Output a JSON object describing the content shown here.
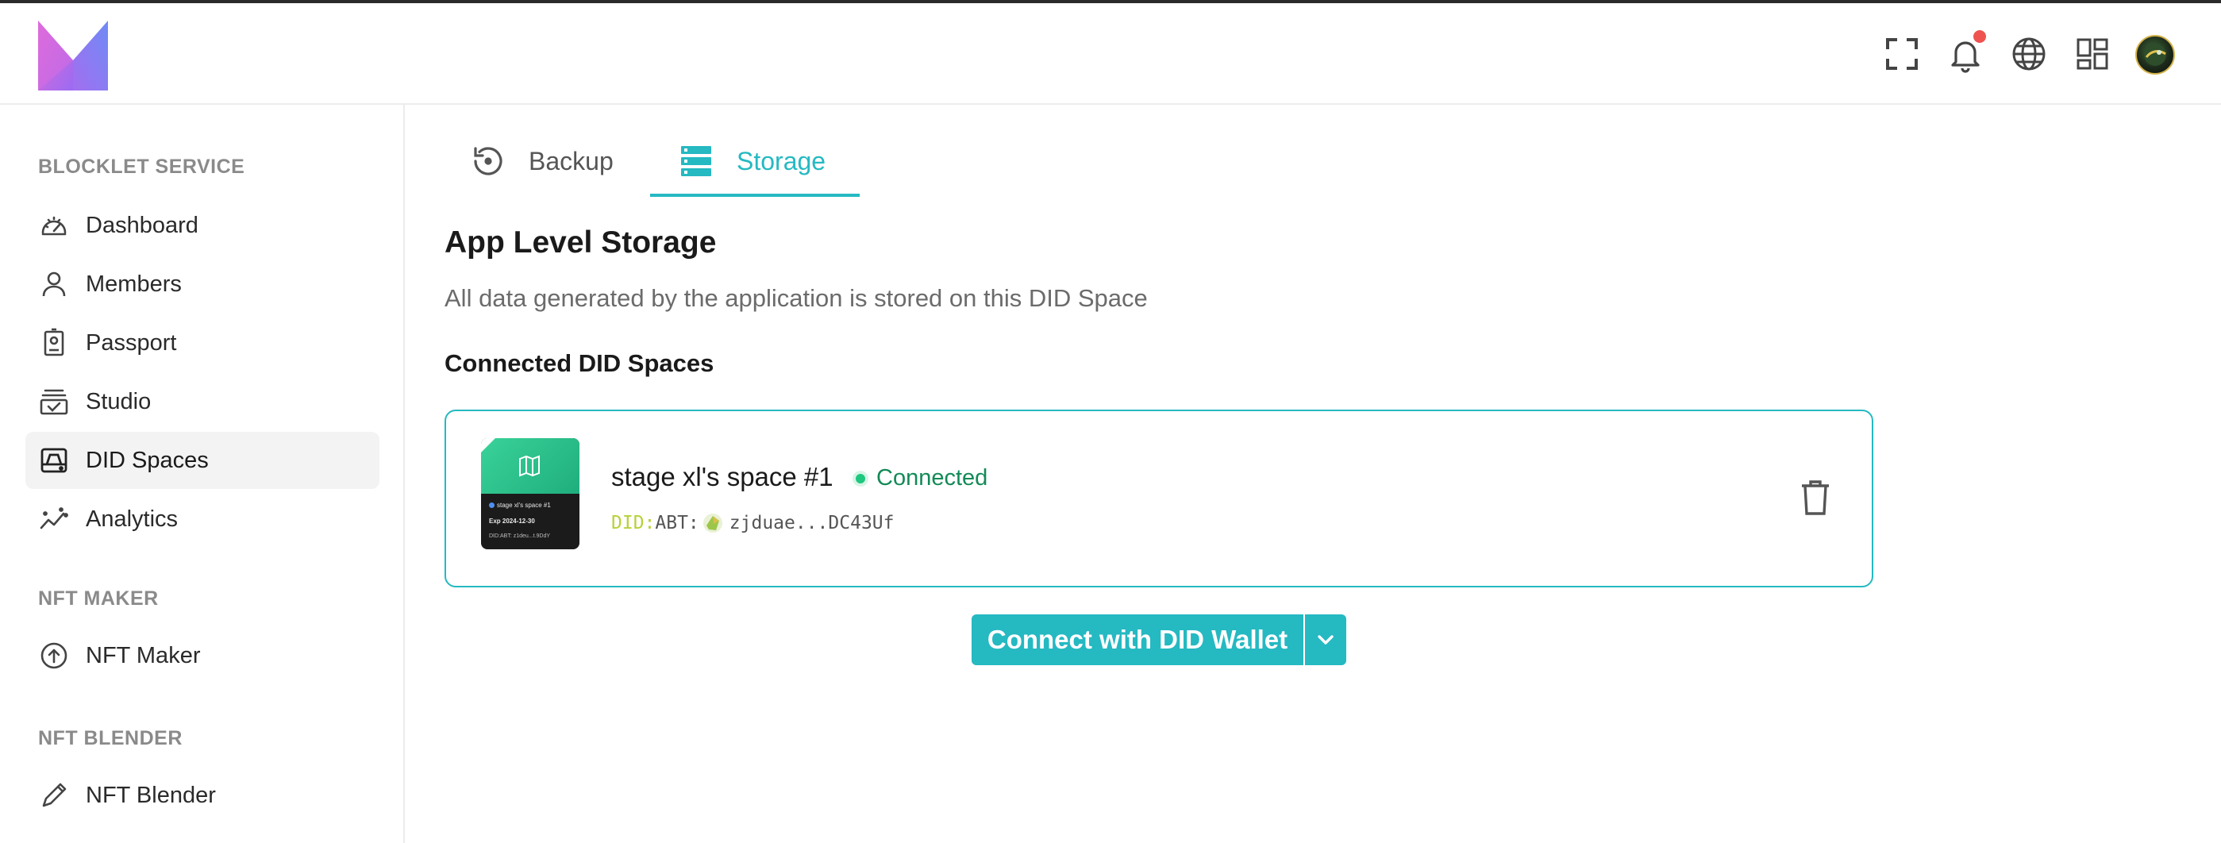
{
  "colors": {
    "accent": "#25b9c2",
    "connected": "#1fc77f",
    "notification": "#ef5350"
  },
  "header": {
    "logo_icon": "blocklet-logo",
    "icons": [
      "fullscreen-icon",
      "bell-icon",
      "globe-icon",
      "apps-grid-icon",
      "user-avatar"
    ]
  },
  "sidebar": {
    "sections": [
      {
        "title": "BLOCKLET SERVICE",
        "items": [
          {
            "label": "Dashboard",
            "icon": "gauge-icon"
          },
          {
            "label": "Members",
            "icon": "person-icon"
          },
          {
            "label": "Passport",
            "icon": "passport-icon"
          },
          {
            "label": "Studio",
            "icon": "studio-icon"
          },
          {
            "label": "DID Spaces",
            "icon": "storage-drive-icon",
            "active": true
          },
          {
            "label": "Analytics",
            "icon": "analytics-icon"
          }
        ]
      },
      {
        "title": "NFT MAKER",
        "items": [
          {
            "label": "NFT Maker",
            "icon": "upload-circle-icon"
          }
        ]
      },
      {
        "title": "NFT BLENDER",
        "items": [
          {
            "label": "NFT Blender",
            "icon": "pen-icon"
          }
        ]
      }
    ]
  },
  "tabs": [
    {
      "label": "Backup",
      "icon": "history-icon",
      "active": false
    },
    {
      "label": "Storage",
      "icon": "storage-list-icon",
      "active": true
    }
  ],
  "main": {
    "title": "App Level Storage",
    "description": "All data generated by the application is stored on this DID Space",
    "section_title": "Connected DID Spaces",
    "space": {
      "name": "stage xl's space #1",
      "status": "Connected",
      "did_prefix": "DID:",
      "did_method": "ABT:",
      "did_value": "zjduae...DC43Uf",
      "thumbnail": {
        "line1": "stage xl's space #1",
        "line2": "Exp  2024-12-30",
        "line3": "DID:ABT:  z1deu...t.9DdY"
      }
    },
    "connect_button": "Connect with DID Wallet"
  }
}
